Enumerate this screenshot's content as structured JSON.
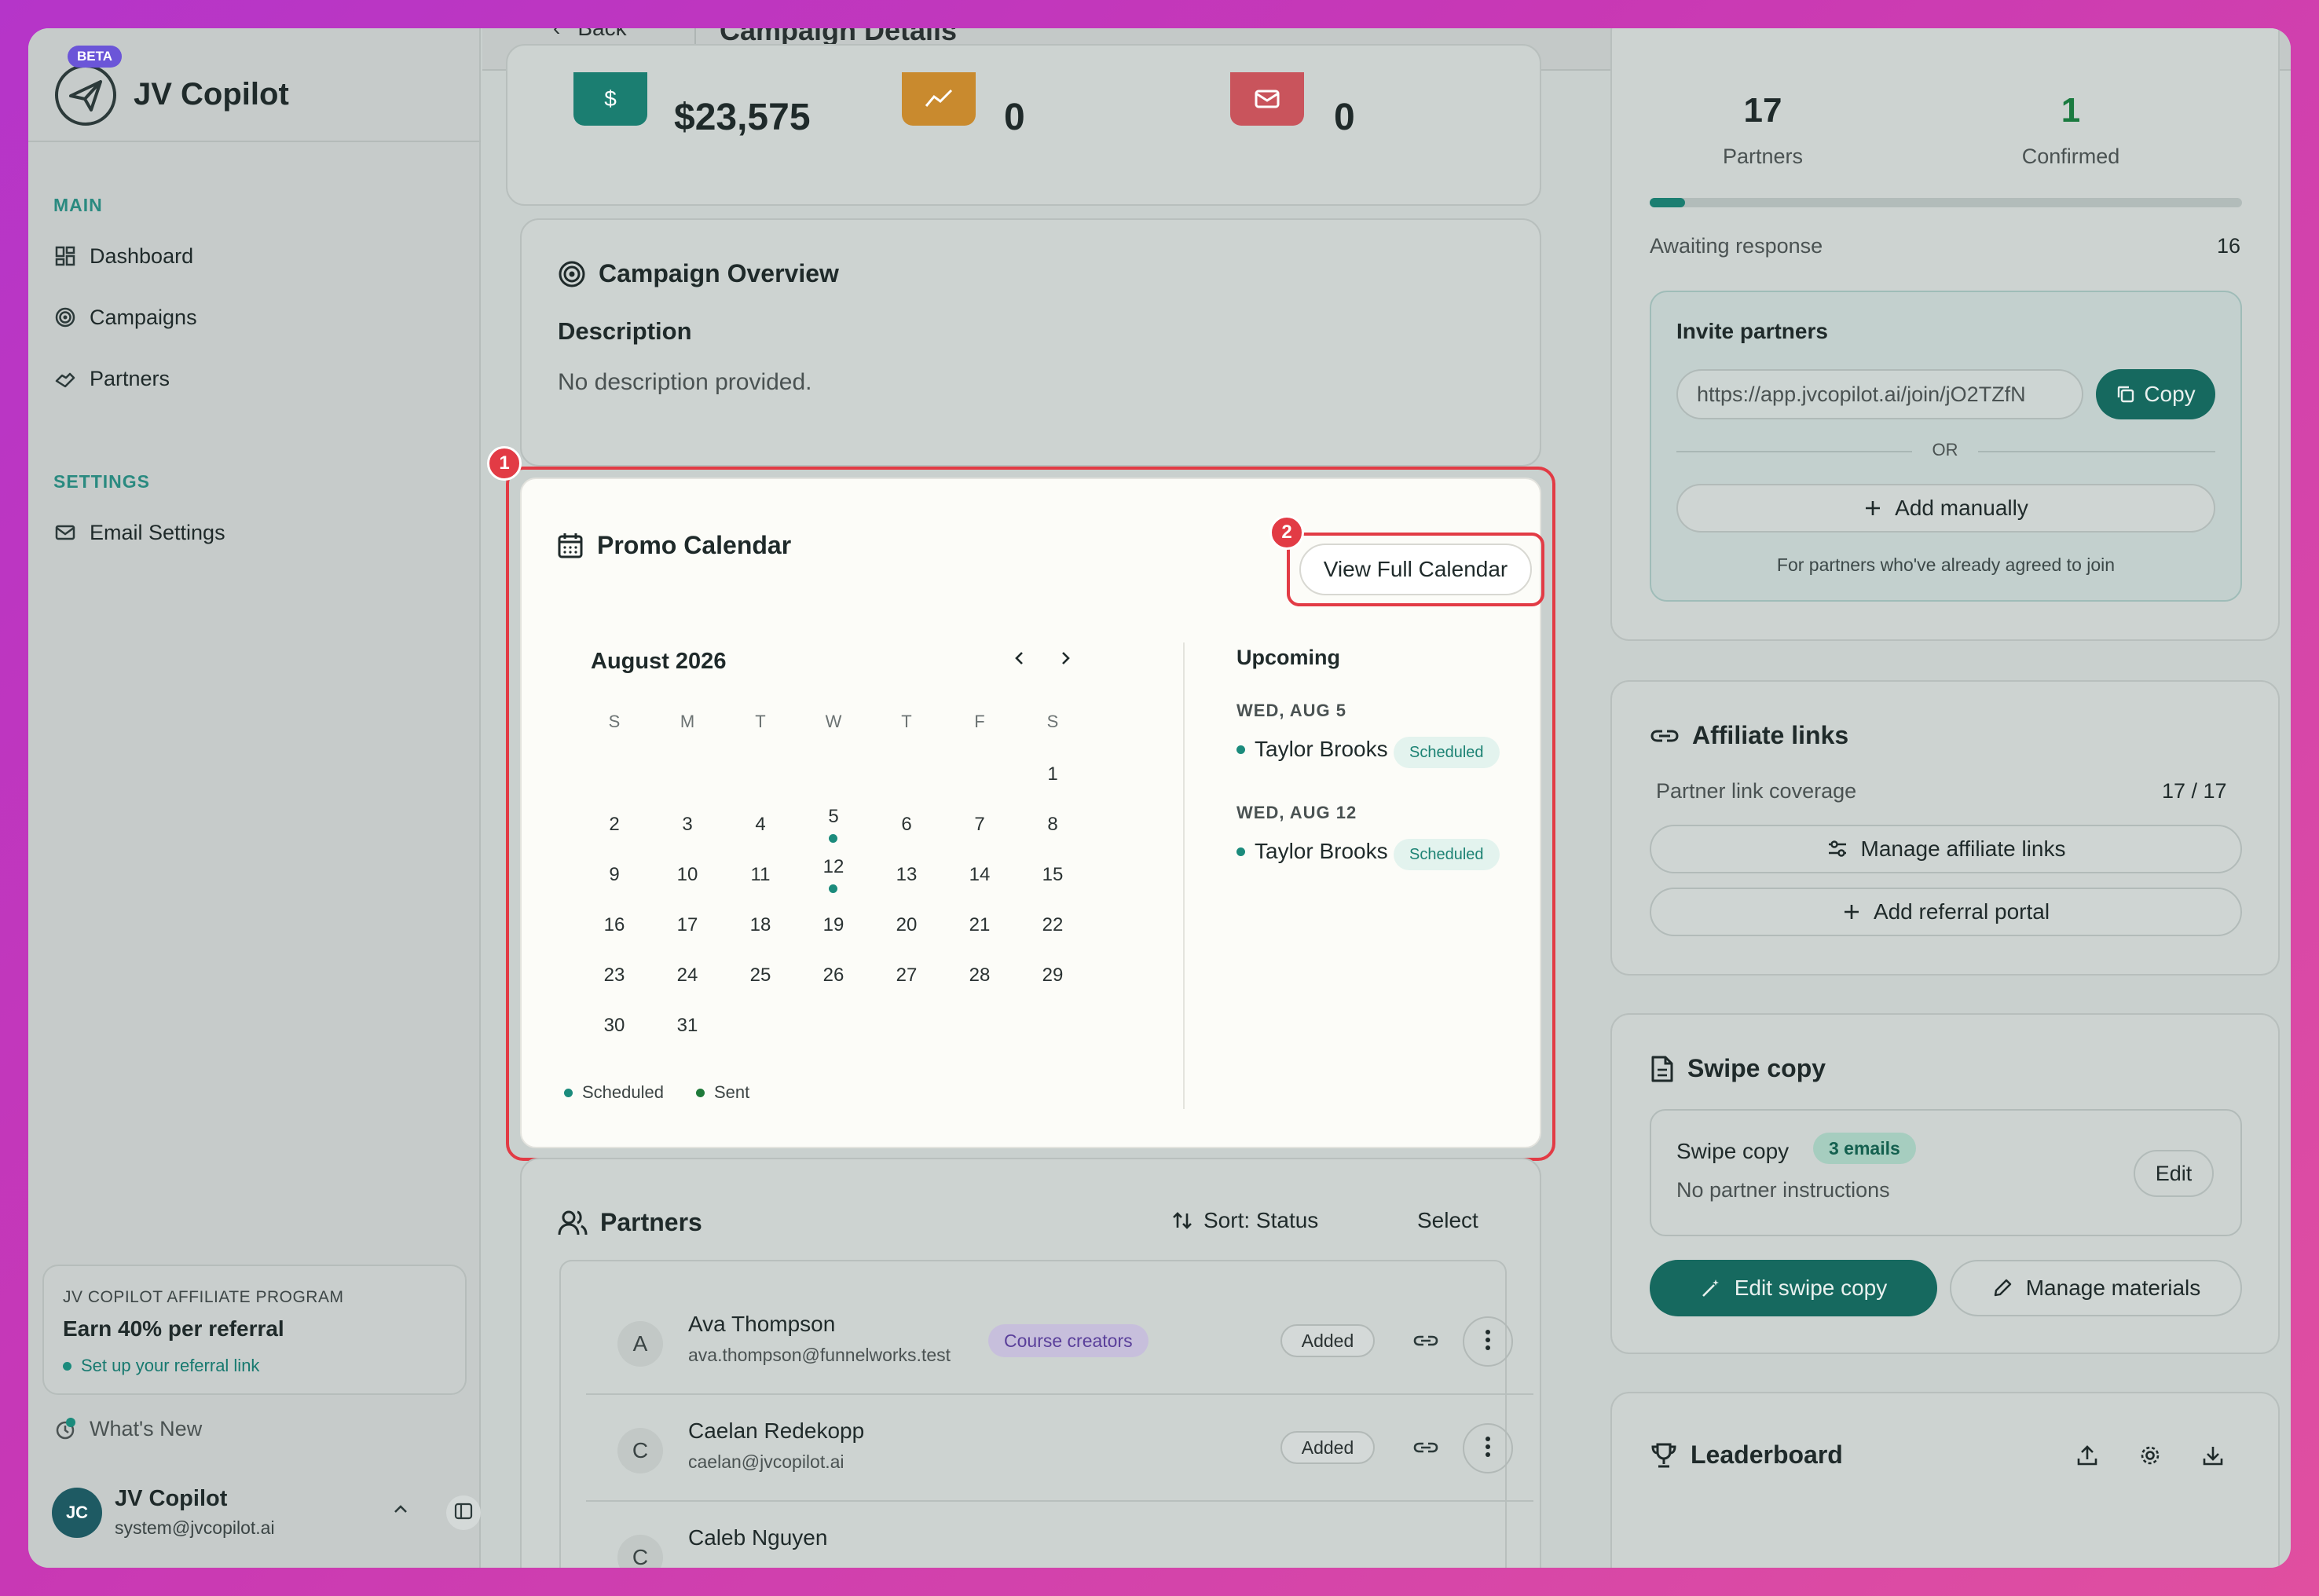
{
  "app": {
    "name": "JV Copilot",
    "beta": "BETA"
  },
  "sidebar": {
    "main_section": "MAIN",
    "items": [
      {
        "label": "Dashboard",
        "icon": "dashboard-icon"
      },
      {
        "label": "Campaigns",
        "icon": "target-icon"
      },
      {
        "label": "Partners",
        "icon": "handshake-icon"
      }
    ],
    "settings_section": "SETTINGS",
    "settings_items": [
      {
        "label": "Email Settings",
        "icon": "mail-icon"
      }
    ],
    "affiliate": {
      "label": "JV COPILOT AFFILIATE PROGRAM",
      "title": "Earn 40% per referral",
      "link": "Set up your referral link"
    },
    "whats_new": "What's New",
    "user": {
      "initials": "JC",
      "name": "JV Copilot",
      "email": "system@jvcopilot.ai"
    }
  },
  "topbar": {
    "back": "Back",
    "title": "Campaign Details"
  },
  "stats": [
    {
      "value": "$23,575",
      "icon": "dollar-icon",
      "color": "#1b7e71"
    },
    {
      "value": "0",
      "icon": "trending-icon",
      "color": "#c98a2e"
    },
    {
      "value": "0",
      "icon": "mail-icon",
      "color": "#c9545c"
    }
  ],
  "overview": {
    "title": "Campaign Overview",
    "description_label": "Description",
    "description": "No description provided."
  },
  "promo": {
    "badge_1": "1",
    "badge_2": "2",
    "title": "Promo Calendar",
    "view_full": "View Full Calendar",
    "month": "August 2026",
    "weekdays": [
      "S",
      "M",
      "T",
      "W",
      "T",
      "F",
      "S"
    ],
    "first_weekday": 6,
    "days_in_month": 31,
    "event_days": [
      5,
      12
    ],
    "legend": {
      "scheduled": "Scheduled",
      "sent": "Sent"
    },
    "upcoming_title": "Upcoming",
    "upcoming": [
      {
        "date": "WED, AUG 5",
        "name": "Taylor Brooks",
        "status": "Scheduled"
      },
      {
        "date": "WED, AUG 12",
        "name": "Taylor Brooks",
        "status": "Scheduled"
      }
    ]
  },
  "partners": {
    "title": "Partners",
    "sort": "Sort: Status",
    "select": "Select",
    "rows": [
      {
        "initial": "A",
        "name": "Ava Thompson",
        "email": "ava.thompson@funnelworks.test",
        "tag": "Course creators",
        "status": "Added"
      },
      {
        "initial": "C",
        "name": "Caelan Redekopp",
        "email": "caelan@jvcopilot.ai",
        "tag": "",
        "status": "Added"
      },
      {
        "initial": "C",
        "name": "Caleb Nguyen",
        "email": "",
        "tag": "",
        "status": ""
      }
    ]
  },
  "right": {
    "partners_count": "17",
    "partners_label": "Partners",
    "confirmed_count": "1",
    "confirmed_label": "Confirmed",
    "progress": 0.06,
    "awaiting_label": "Awaiting response",
    "awaiting_count": "16",
    "invite": {
      "title": "Invite partners",
      "url": "https://app.jvcopilot.ai/join/jO2TZfN",
      "copy": "Copy",
      "or": "OR",
      "add_manually": "Add manually",
      "note": "For partners who've already agreed to join"
    },
    "affiliate_links": {
      "title": "Affiliate links",
      "coverage_label": "Partner link coverage",
      "coverage": "17 / 17",
      "manage": "Manage affiliate links",
      "add_portal": "Add referral portal"
    },
    "swipe": {
      "title": "Swipe copy",
      "inner_title": "Swipe copy",
      "count": "3 emails",
      "instructions": "No partner instructions",
      "edit": "Edit",
      "edit_swipe": "Edit swipe copy",
      "manage_materials": "Manage materials"
    },
    "leaderboard": {
      "title": "Leaderboard"
    }
  }
}
